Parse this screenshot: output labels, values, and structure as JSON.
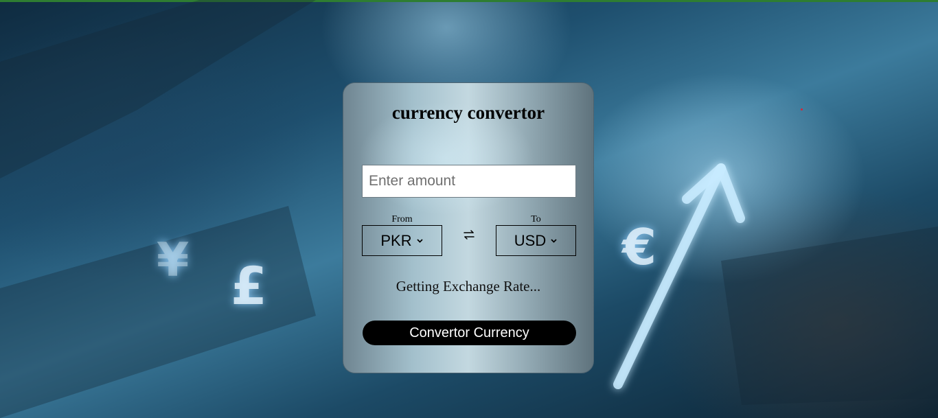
{
  "app": {
    "title": "currency convertor"
  },
  "amount_input": {
    "value": "",
    "placeholder": "Enter amount"
  },
  "from": {
    "label": "From",
    "selected": "PKR"
  },
  "to": {
    "label": "To",
    "selected": "USD"
  },
  "exchange_rate_text": "Getting Exchange Rate...",
  "convert_button_label": "Convertor Currency",
  "background": {
    "glyphs": [
      "¥",
      "£",
      "€"
    ]
  },
  "colors": {
    "top_bar": "#2e7d32",
    "button_bg": "#000000",
    "button_text": "#ffffff"
  },
  "icons": {
    "swap": "swap-arrows-icon",
    "dropdown": "chevron-down-icon"
  }
}
